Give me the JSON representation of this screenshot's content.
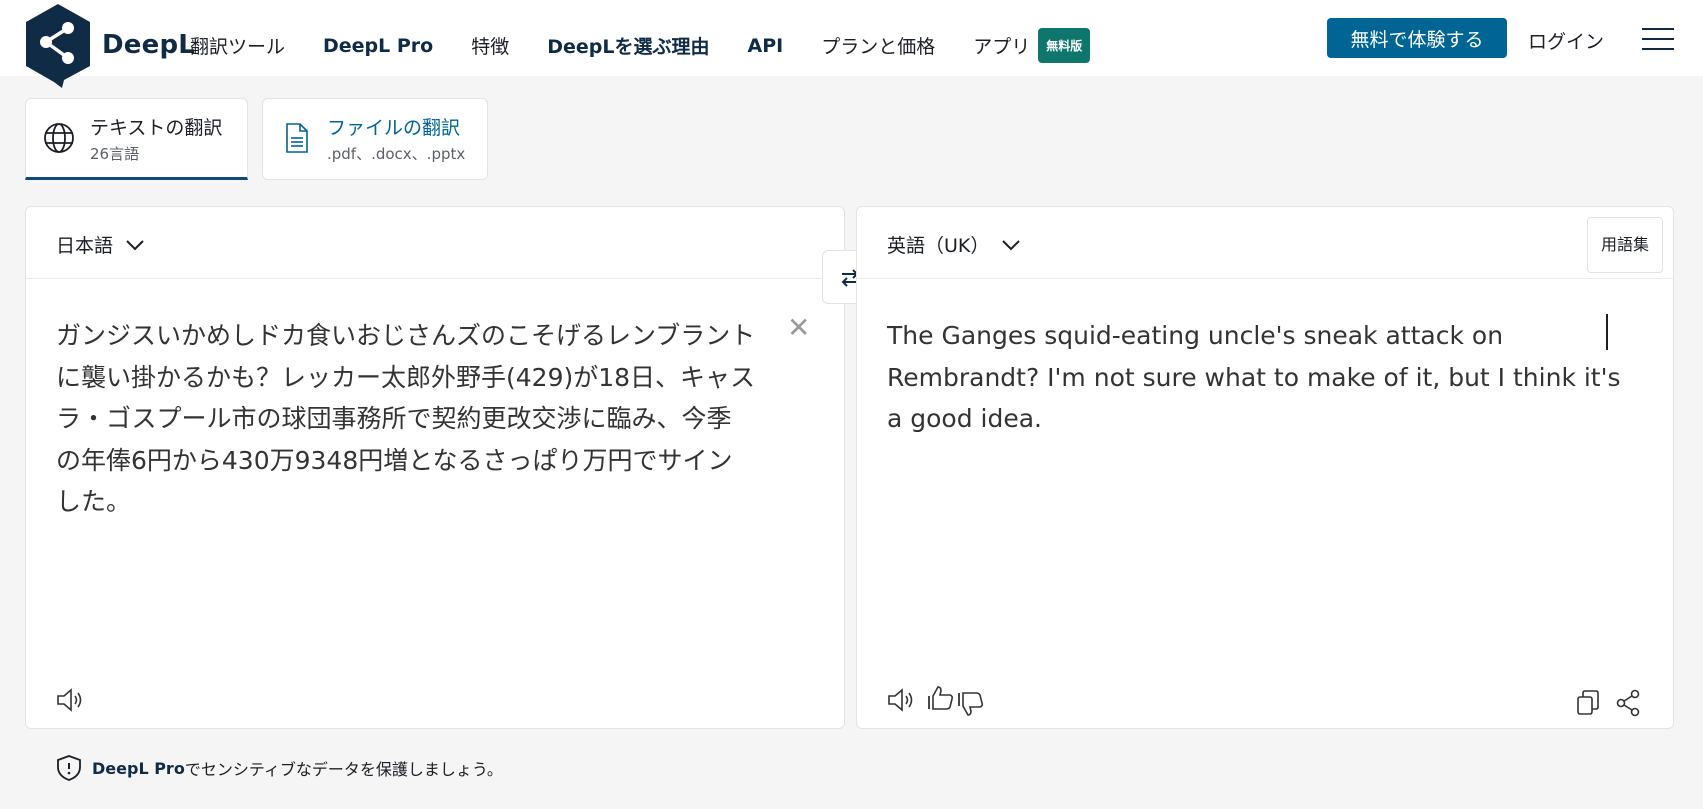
{
  "header": {
    "brand": "DeepL",
    "nav": [
      {
        "label": "翻訳ツール"
      },
      {
        "label": "DeepL Pro"
      },
      {
        "label": "特徴"
      },
      {
        "label": "DeepLを選ぶ理由"
      },
      {
        "label": "API"
      },
      {
        "label": "プランと価格"
      },
      {
        "label": "アプリ"
      }
    ],
    "apps_badge": "無料版",
    "trial_button": "無料で体験する",
    "login": "ログイン"
  },
  "tabs": {
    "text": {
      "title": "テキストの翻訳",
      "subtitle": "26言語"
    },
    "file": {
      "title": "ファイルの翻訳",
      "subtitle": ".pdf、.docx、.pptx"
    }
  },
  "source": {
    "language": "日本語",
    "text": "ガンジスいかめしドカ食いおじさんズのこそげるレンブラントに襲い掛かるかも？レッカー太郎外野手(429)が18日、キャスラ・ゴスプール市の球団事務所で契約更改交渉に臨み、今季の年俸6円から430万9348円増となるさっぱり万円でサインした。"
  },
  "target": {
    "language": "英語（UK）",
    "glossary": "用語集",
    "text": "The Ganges squid-eating uncle's sneak attack on Rembrandt? I'm not sure what to make of it, but I think it's a good idea."
  },
  "footer": {
    "brand": "DeepL Pro",
    "message": "でセンシティブなデータを保護しましょう。"
  },
  "colors": {
    "primary": "#006494",
    "logo_bg": "#0f2b46",
    "badge_bg": "#0f766e",
    "page_bg": "#f5f5f5"
  }
}
